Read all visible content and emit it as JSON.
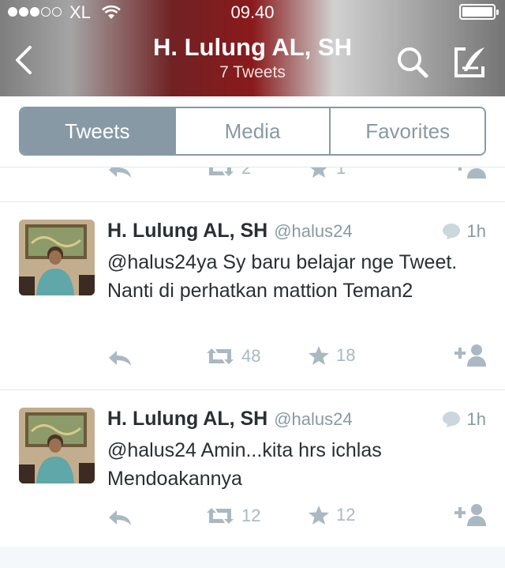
{
  "status_bar": {
    "carrier": "XL",
    "time": "09.40",
    "signal_bars_filled": 3,
    "signal_bars_total": 5,
    "battery_level": 1.0
  },
  "nav": {
    "title": "H. Lulung AL, SH",
    "subtitle": "7 Tweets",
    "back_icon": "chevron-left-icon",
    "search_icon": "search-icon",
    "compose_icon": "compose-icon"
  },
  "tabs": {
    "items": [
      "Tweets",
      "Media",
      "Favorites"
    ],
    "selected": "Tweets"
  },
  "partial_tweet": {
    "retweets": "2",
    "favorites": "1"
  },
  "tweets": [
    {
      "name": "H. Lulung AL, SH",
      "handle": "@halus24",
      "time": "1h",
      "text": "@halus24ya Sy baru belajar nge Tweet. Nanti di perhatkan mattion Teman2",
      "retweets": "48",
      "favorites": "18"
    },
    {
      "name": "H. Lulung AL, SH",
      "handle": "@halus24",
      "time": "1h",
      "text": "@halus24 Amin...kita hrs ichlas Mendoakannya",
      "retweets": "12",
      "favorites": "12"
    }
  ],
  "colors": {
    "accent": "#8899a6",
    "text": "#292f33",
    "muted": "#aab8c2"
  }
}
